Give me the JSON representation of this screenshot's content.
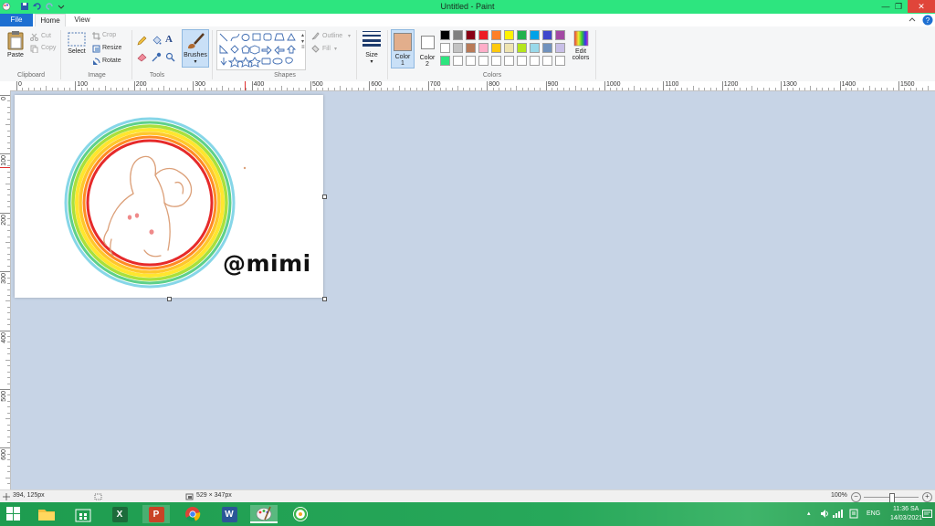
{
  "window": {
    "title": "Untitled - Paint",
    "minimize": "—",
    "maximize": "❐",
    "close": "✕"
  },
  "tabs": {
    "file": "File",
    "home": "Home",
    "view": "View"
  },
  "ribbon": {
    "clipboard": {
      "label": "Clipboard",
      "paste": "Paste",
      "cut": "Cut",
      "copy": "Copy"
    },
    "image": {
      "label": "Image",
      "select": "Select",
      "crop": "Crop",
      "resize": "Resize",
      "rotate": "Rotate"
    },
    "tools": {
      "label": "Tools",
      "brushes": "Brushes"
    },
    "shapes": {
      "label": "Shapes",
      "outline": "Outline",
      "fill": "Fill"
    },
    "size": {
      "label": "Size"
    },
    "colors": {
      "label": "Colors",
      "color1": "Color",
      "color1_num": "1",
      "color2": "Color",
      "color2_num": "2",
      "edit_line1": "Edit",
      "edit_line2": "colors",
      "color1_value": "#e2ae8c",
      "color2_value": "#ffffff",
      "palette_row1": [
        "#000000",
        "#7f7f7f",
        "#880015",
        "#ed1c24",
        "#ff7f27",
        "#fff200",
        "#22b14c",
        "#00a2e8",
        "#3f48cc",
        "#a349a4"
      ],
      "palette_row2": [
        "#ffffff",
        "#c3c3c3",
        "#b97a57",
        "#ffaec9",
        "#ffc90e",
        "#efe4b0",
        "#b5e61d",
        "#99d9ea",
        "#7092be",
        "#c8bfe7"
      ],
      "palette_row3": [
        "#2de57f",
        "#ffffff",
        "#ffffff",
        "#ffffff",
        "#ffffff",
        "#ffffff",
        "#ffffff",
        "#ffffff",
        "#ffffff",
        "#ffffff"
      ]
    }
  },
  "ruler": {
    "h_labels": [
      "0",
      "100",
      "200",
      "300",
      "400",
      "500",
      "600",
      "700",
      "800",
      "900",
      "1000",
      "1100",
      "1200",
      "1300",
      "1400",
      "1500"
    ],
    "v_labels": [
      "0",
      "100",
      "200",
      "300",
      "400",
      "500",
      "600"
    ]
  },
  "canvas": {
    "text": "@mimi"
  },
  "status": {
    "position": "394, 125px",
    "size": "529 × 347px",
    "zoom": "100%"
  },
  "taskbar": {
    "lang": "ENG",
    "time": "11:36 SA",
    "date": "14/03/2021"
  }
}
